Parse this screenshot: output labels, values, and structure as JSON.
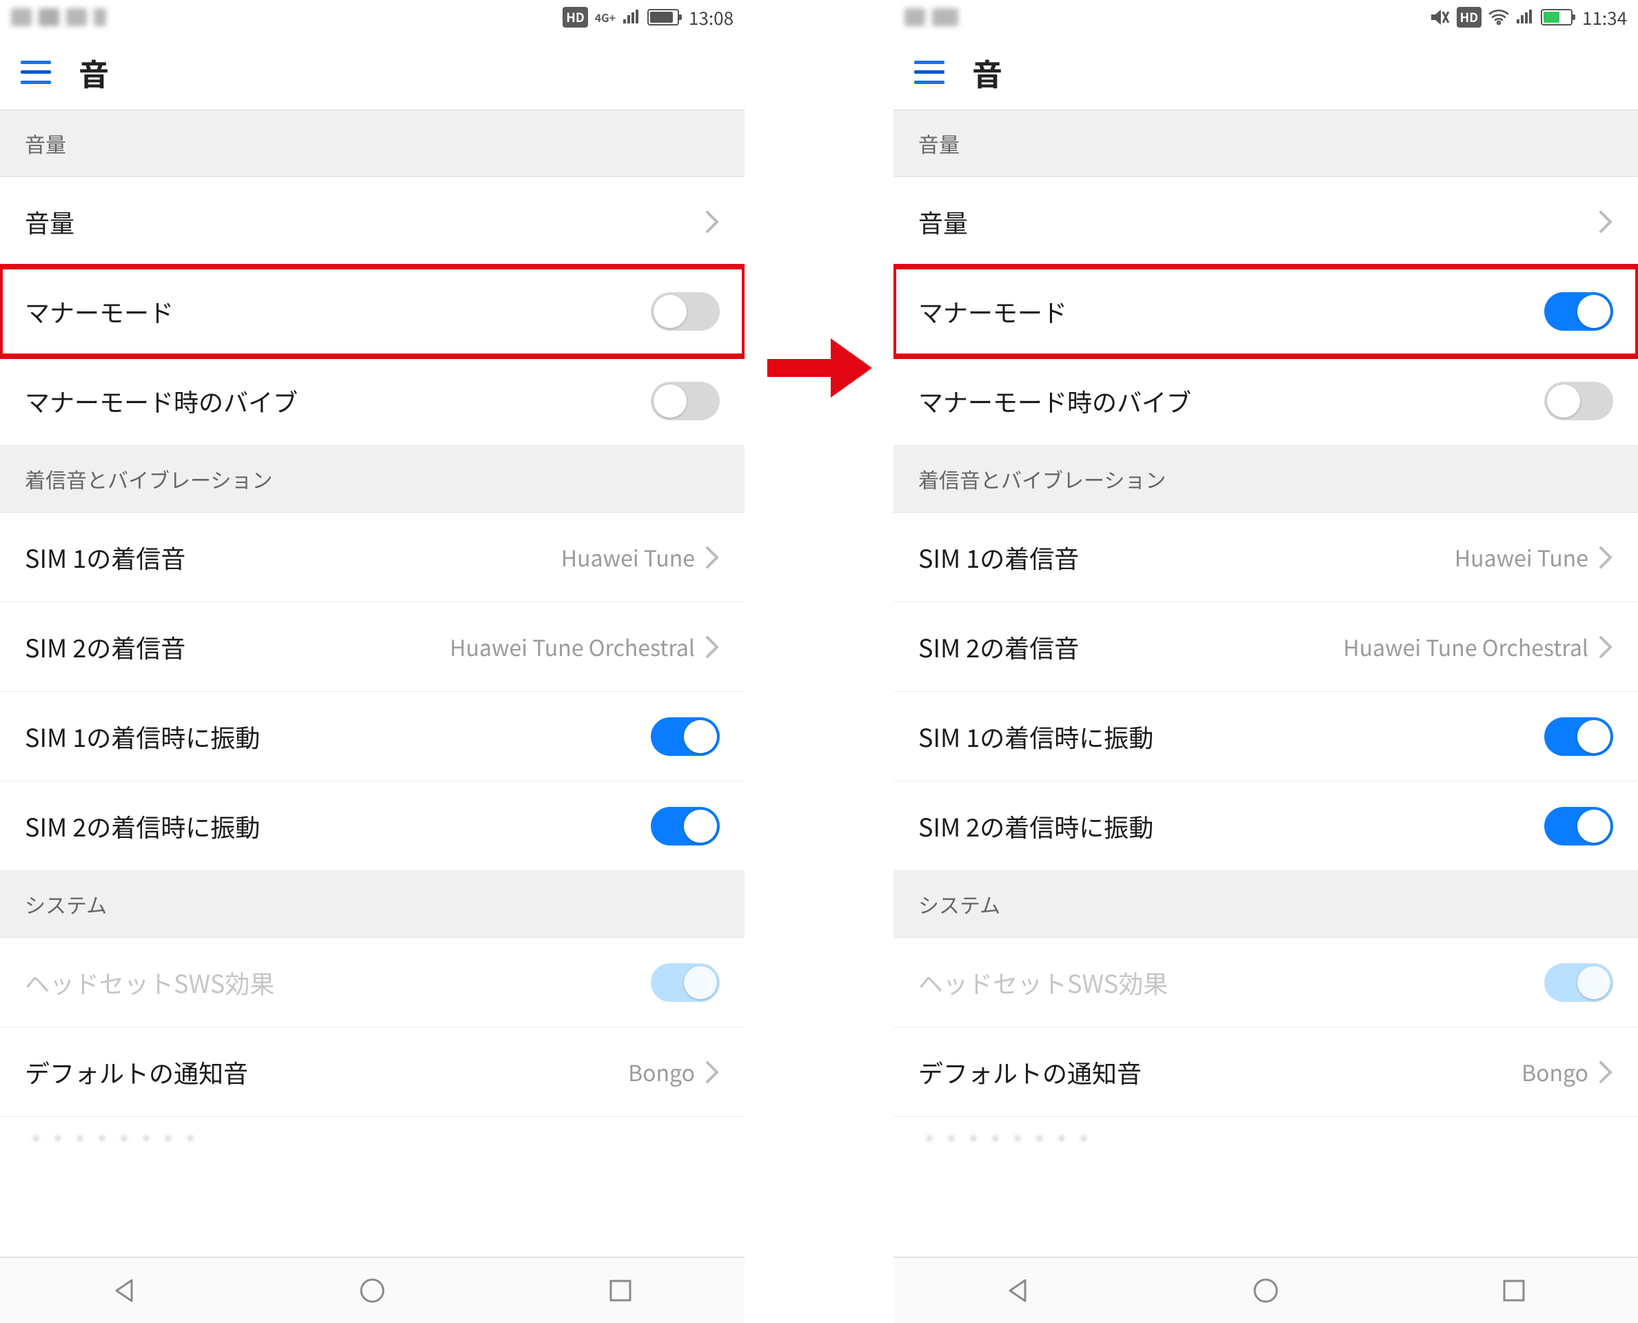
{
  "left": {
    "status": {
      "time": "13:08",
      "hd": "HD",
      "net": "4G+",
      "battery_pct": 80
    },
    "title": "音",
    "sections": {
      "volume_head": "音量",
      "volume_row": "音量",
      "manner_mode": "マナーモード",
      "manner_vibe": "マナーモード時のバイブ",
      "ring_head": "着信音とバイブレーション",
      "sim1_ring": "SIM 1の着信音",
      "sim1_ring_val": "Huawei Tune",
      "sim2_ring": "SIM 2の着信音",
      "sim2_ring_val": "Huawei Tune Orchestral",
      "sim1_vibe": "SIM 1の着信時に振動",
      "sim2_vibe": "SIM 2の着信時に振動",
      "system_head": "システム",
      "sws": "ヘッドセットSWS効果",
      "default_notif": "デフォルトの通知音",
      "default_notif_val": "Bongo"
    },
    "toggles": {
      "manner_mode": false,
      "manner_vibe": false,
      "sim1_vibe": true,
      "sim2_vibe": true,
      "sws": true
    }
  },
  "right": {
    "status": {
      "time": "11:34",
      "hd": "HD",
      "battery_pct": 55,
      "charging": true,
      "muted": true
    },
    "title": "音",
    "sections": {
      "volume_head": "音量",
      "volume_row": "音量",
      "manner_mode": "マナーモード",
      "manner_vibe": "マナーモード時のバイブ",
      "ring_head": "着信音とバイブレーション",
      "sim1_ring": "SIM 1の着信音",
      "sim1_ring_val": "Huawei Tune",
      "sim2_ring": "SIM 2の着信音",
      "sim2_ring_val": "Huawei Tune Orchestral",
      "sim1_vibe": "SIM 1の着信時に振動",
      "sim2_vibe": "SIM 2の着信時に振動",
      "system_head": "システム",
      "sws": "ヘッドセットSWS効果",
      "default_notif": "デフォルトの通知音",
      "default_notif_val": "Bongo"
    },
    "toggles": {
      "manner_mode": true,
      "manner_vibe": false,
      "sim1_vibe": true,
      "sim2_vibe": true,
      "sws": true
    }
  }
}
